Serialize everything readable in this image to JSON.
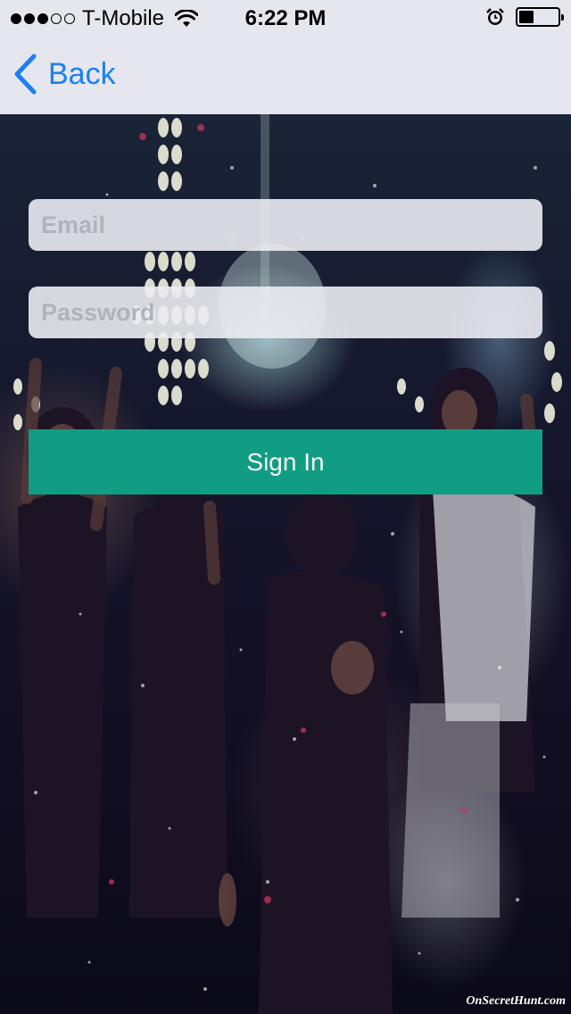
{
  "status_bar": {
    "carrier": "T-Mobile",
    "signal_strength": 3,
    "signal_max": 5,
    "time": "6:22 PM",
    "battery_level": 0.35,
    "icons": [
      "signal-dots",
      "wifi-icon",
      "alarm-icon",
      "battery-icon"
    ]
  },
  "nav": {
    "back_label": "Back",
    "accent_color": "#1a80f5"
  },
  "form": {
    "email_placeholder": "Email",
    "email_value": "",
    "password_placeholder": "Password",
    "password_value": "",
    "signin_label": "Sign In",
    "button_color": "#119d83"
  },
  "background": {
    "watermark": "OnSecretHunt.com"
  }
}
